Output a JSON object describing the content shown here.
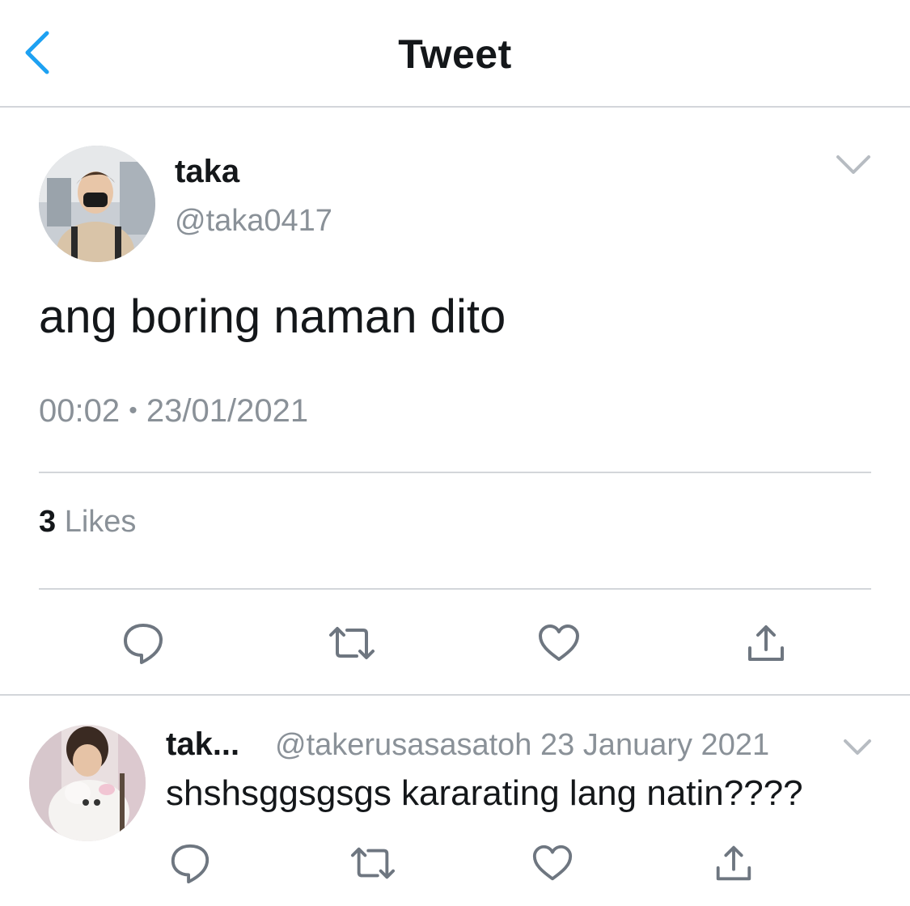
{
  "header": {
    "title": "Tweet",
    "back_icon": "chevron-left-icon"
  },
  "tweet": {
    "display_name": "taka",
    "handle": "@taka0417",
    "text": "ang boring naman dito",
    "time": "00:02",
    "separator": "•",
    "date": "23/01/2021",
    "likes_count": "3",
    "likes_label": "Likes",
    "actions": [
      "reply-icon",
      "retweet-icon",
      "like-icon",
      "share-icon"
    ]
  },
  "reply": {
    "display_name": "tak...",
    "handle": "@takerusasasatoh",
    "date": "23 January 2021",
    "text": "shshsggsgsgs kararating lang natin????",
    "actions": [
      "reply-icon",
      "retweet-icon",
      "like-icon",
      "share-icon"
    ]
  },
  "colors": {
    "accent": "#1da1f2",
    "text": "#14171a",
    "muted": "#8a9198",
    "divider": "#d3d6da"
  }
}
